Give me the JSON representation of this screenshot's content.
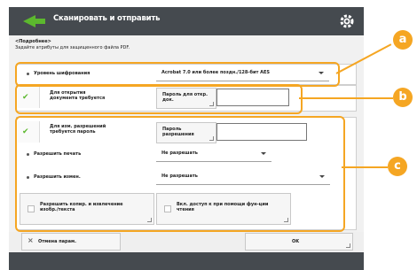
{
  "header": {
    "title": "Сканировать и отправить"
  },
  "section": {
    "heading": "<Подробнее>",
    "subtitle": "Задайте атрибуты для защищенного файла PDF."
  },
  "group_a": {
    "level_label": "Уровень шифрования",
    "level_value": "Acrobat 7.0 или более поздн./128-бит AES"
  },
  "group_b": {
    "open_label": "Для открытия документа требуется",
    "open_button": "Пароль для откр. док.",
    "open_input": ""
  },
  "group_c": {
    "perm_label": "Для изм. разрешений требуется пароль",
    "perm_button": "Пароль разрешения",
    "perm_input": "",
    "print_label": "Разрешить печать",
    "print_value": "Не разрешать",
    "change_label": "Разрешить измен.",
    "change_value": "Не разрешать",
    "copy_label": "Разрешить копир. и извлечение изобр./текста",
    "access_label": "Вкл. доступ к при помощи фун-ции чтения"
  },
  "footer": {
    "cancel": "Отмена парам.",
    "ok": "OK"
  },
  "callouts": [
    "a",
    "b",
    "c"
  ],
  "colors": {
    "accent": "#f5a623",
    "check": "#5cb82e",
    "title_bg": "#454a4f"
  }
}
